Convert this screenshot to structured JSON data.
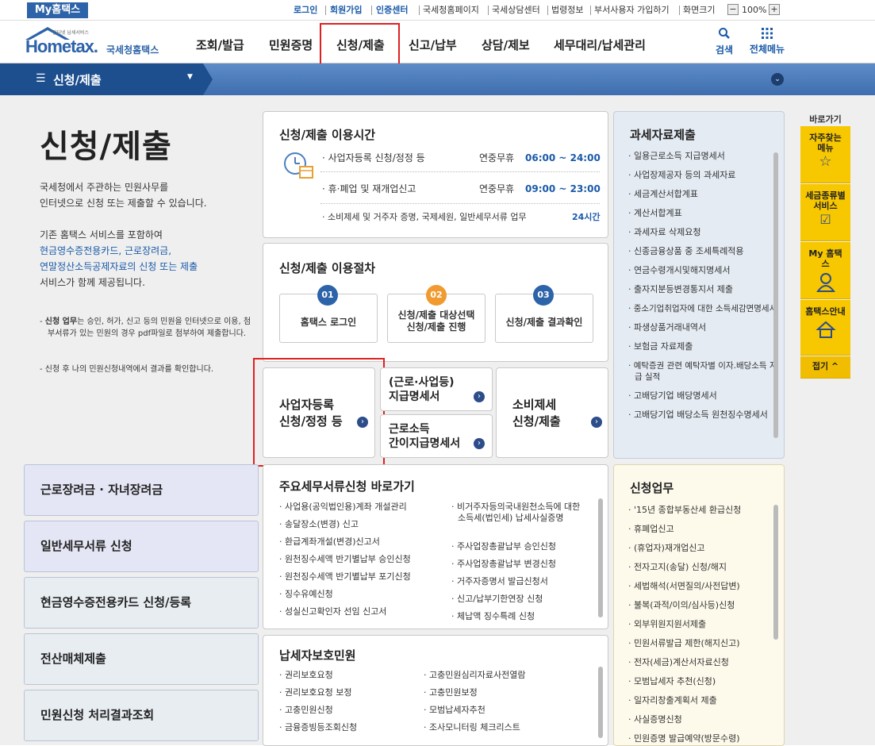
{
  "topbar": {
    "myhometax": "My홈택스",
    "links_blue": [
      "로그인",
      "회원가입",
      "인증센터"
    ],
    "links": [
      "국세청홈페이지",
      "국세상담센터",
      "법령정보",
      "부서사용자 가입하기",
      "화면크기"
    ],
    "zoom": "100%",
    "zoom_minus": "−",
    "zoom_plus": "+"
  },
  "header": {
    "logo_small": "인터넷 납세서비스",
    "logo_main": "Hometax.",
    "logo_sub": "국세청홈택스",
    "nav": [
      "조회/발급",
      "민원증명",
      "신청/제출",
      "신고/납부",
      "상담/제보",
      "세무대리/납세관리"
    ],
    "search": "검색",
    "allmenu": "전체메뉴"
  },
  "subbar": {
    "menu": "신청/제출"
  },
  "page": {
    "title": "신청/제출",
    "desc1": "국세청에서 주관하는 민원사무를",
    "desc2": "인터넷으로 신청 또는 제출할 수 있습니다.",
    "desc3": "기존 홈택스 서비스를 포함하여",
    "desc4": "현금영수증전용카드, 근로장려금,",
    "desc5": "연말정산소득공제자료의 신청 또는 제출",
    "desc6": "서비스가 함께 제공됩니다.",
    "note1_bold": "신청 업무",
    "note1": "는 승인, 허가, 신고 등의 민원을 인터넷으로 이용, 첨부서류가 있는 민원의 경우 pdf파일로 첨부하여 제출합니다.",
    "note2": "신청 후 나의 민원신청내역에서 결과를 확인합니다."
  },
  "hours": {
    "title": "신청/제출 이용시간",
    "rows": [
      {
        "item": "· 사업자등록 신청/정정 등",
        "days": "연중무휴",
        "time": "06:00 ~ 24:00"
      },
      {
        "item": "· 휴·폐업 및 재개업신고",
        "days": "연중무휴",
        "time": "09:00 ~ 23:00"
      },
      {
        "item": "· 소비제세 및 거주자 증명, 국제세원, 일반세무서류 업무",
        "days": "",
        "time": "24시간"
      }
    ]
  },
  "procedure": {
    "title": "신청/제출 이용절차",
    "steps": [
      {
        "num": "01",
        "line1": "홈택스 로그인",
        "line2": ""
      },
      {
        "num": "02",
        "line1": "신청/제출 대상선택",
        "line2": "신청/제출 진행"
      },
      {
        "num": "03",
        "line1": "신청/제출 결과확인",
        "line2": ""
      }
    ]
  },
  "tiles": {
    "biz1": "사업자등록",
    "biz2": "신청/정정 등",
    "wage1": "(근로·사업등)",
    "wage2": "지급명세서",
    "simple1": "근로소득",
    "simple2": "간이지급명세서",
    "consume1": "소비제세",
    "consume2": "신청/제출"
  },
  "taxdata": {
    "title": "과세자료제출",
    "items": [
      "일용근로소득 지급명세서",
      "사업장제공자 등의 과세자료",
      "세금계산서합계표",
      "계산서합계표",
      "과세자료 삭제요청",
      "신종금융상품 중 조세특례적용",
      "연금수령개시및해지명세서",
      "출자지분등변경통지서 제출",
      "중소기업취업자에 대한 소득세감면명세서",
      "파생상품거래내역서",
      "보험금 자료제출",
      "예탁증권 관련 예탁자별 이자.배당소득 지급 실적",
      "고배당기업 배당명세서",
      "고배당기업 배당소득 원천징수명세서"
    ]
  },
  "leftmenu": [
    "근로장려금 · 자녀장려금",
    "일반세무서류 신청",
    "현금영수증전용카드 신청/등록",
    "전산매체제출",
    "민원신청 처리결과조회"
  ],
  "docs": {
    "title": "주요세무서류신청 바로가기",
    "col1": [
      "사업용(공익법인용)계좌 개설관리",
      "송달장소(변경) 신고",
      "환급계좌개설(변경)신고서",
      "원천징수세액 반기별납부 승인신청",
      "원천징수세액 반기별납부 포기신청",
      "징수유예신청",
      "성실신고확인자 선임 신고서"
    ],
    "col2": [
      "비거주자등의국내원천소득에 대한 소득세(법인세) 납세사실증명",
      "주사업장총괄납부 승인신청",
      "주사업장총괄납부 변경신청",
      "거주자증명서 발급신청서",
      "신고/납부기한연장 신청",
      "체납액 징수특례 신청"
    ]
  },
  "protect": {
    "title": "납세자보호민원",
    "col1": [
      "권리보호요청",
      "권리보호요청 보정",
      "고충민원신청",
      "금융증빙등조회신청"
    ],
    "col2": [
      "고충민원심리자료사전열람",
      "고충민원보정",
      "모범납세자추천",
      "조사모니터링 체크리스트"
    ]
  },
  "apply": {
    "title": "신청업무",
    "items": [
      "'15년 종합부동산세 환급신청",
      "휴폐업신고",
      "(휴업자)재개업신고",
      "전자고지(송달) 신청/해지",
      "세법해석(서면질의/사전답변)",
      "불복(과적/이의/심사등)신청",
      "외부위원지원서제출",
      "민원서류발급 제한(해지신고)",
      "전자(세금)계산서자료신청",
      "모범납세자 추천(신청)",
      "일자리창출계획서 제출",
      "사실증명신청",
      "민원증명 발급예약(방문수령)"
    ]
  },
  "quick": {
    "title": "바로가기",
    "items": [
      "자주찾는 메뉴",
      "세금종류별 서비스",
      "My 홈택스",
      "홈택스안내"
    ],
    "fold": "접기 ^"
  },
  "colors": {
    "brand": "#2d63a8",
    "highlight": "#e02020",
    "quick": "#f7c700"
  }
}
